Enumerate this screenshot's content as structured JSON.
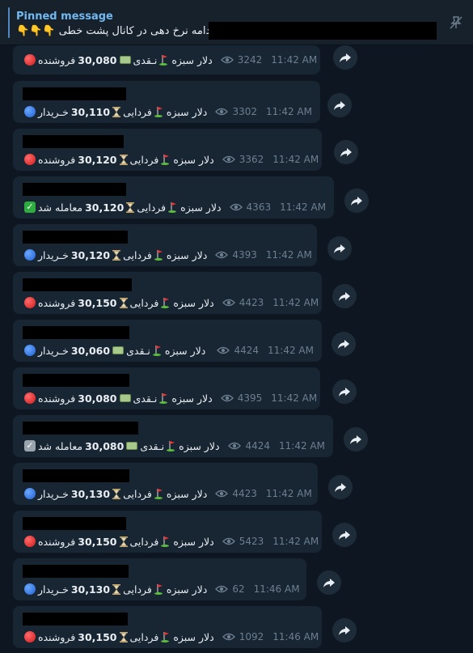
{
  "pinned": {
    "title": "Pinned message",
    "text": "ادامه نرخ دهی در کانال پشت خطی 👇👇👇"
  },
  "messages": [
    {
      "kind": "نـقدی",
      "price": "30,080",
      "status": "فروشنده",
      "status_type": "sell",
      "views": "3242",
      "time": "11:42 AM",
      "item": "دلار سبزه"
    },
    {
      "kind": "فردایی",
      "price": "30,110",
      "status": "خـریدار",
      "status_type": "buy",
      "views": "3302",
      "time": "11:42 AM",
      "item": "دلار سبزه"
    },
    {
      "kind": "فردایی",
      "price": "30,120",
      "status": "فروشنده",
      "status_type": "sell",
      "views": "3362",
      "time": "11:42 AM",
      "item": "دلار سبزه"
    },
    {
      "kind": "فردایی",
      "price": "30,120",
      "status": "معامله شد",
      "status_type": "done",
      "views": "4363",
      "time": "11:42 AM",
      "item": "دلار سبزه"
    },
    {
      "kind": "فردایی",
      "price": "30,120",
      "status": "خـریدار",
      "status_type": "buy",
      "views": "4393",
      "time": "11:42 AM",
      "item": "دلار سبزه"
    },
    {
      "kind": "فردایی",
      "price": "30,150",
      "status": "فروشنده",
      "status_type": "sell",
      "views": "4423",
      "time": "11:42 AM",
      "item": "دلار سبزه"
    },
    {
      "kind": "نـقدی",
      "price": "30,060",
      "status": "خـریدار",
      "status_type": "buy",
      "views": "4424",
      "time": "11:42 AM",
      "item": "دلار سبزه"
    },
    {
      "kind": "نـقدی",
      "price": "30,080",
      "status": "فروشنده",
      "status_type": "sell",
      "views": "4395",
      "time": "11:42 AM",
      "item": "دلار سبزه"
    },
    {
      "kind": "نـقدی",
      "price": "30,080",
      "status": "معامله شد",
      "status_type": "done-gray",
      "views": "4424",
      "time": "11:42 AM",
      "item": "دلار سبزه"
    },
    {
      "kind": "فردایی",
      "price": "30,130",
      "status": "خـریدار",
      "status_type": "buy",
      "views": "4423",
      "time": "11:42 AM",
      "item": "دلار سبزه"
    },
    {
      "kind": "فردایی",
      "price": "30,150",
      "status": "فروشنده",
      "status_type": "sell",
      "views": "5423",
      "time": "11:42 AM",
      "item": "دلار سبزه"
    },
    {
      "kind": "فردایی",
      "price": "30,130",
      "status": "خـریدار",
      "status_type": "buy",
      "views": "62",
      "time": "11:46 AM",
      "item": "دلار سبزه"
    },
    {
      "kind": "فردایی",
      "price": "30,150",
      "status": "فروشنده",
      "status_type": "sell",
      "views": "1092",
      "time": "11:46 AM",
      "item": "دلار سبزه"
    }
  ]
}
